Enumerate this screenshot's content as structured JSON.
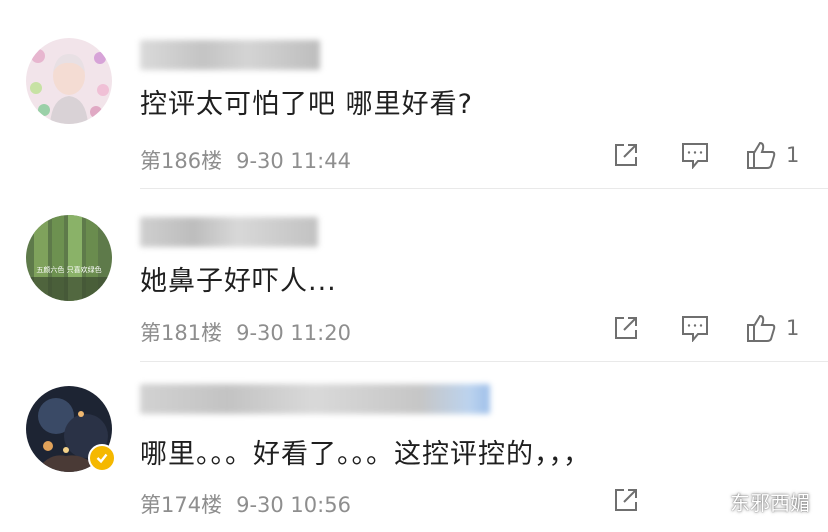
{
  "comments": [
    {
      "text": "控评太可怕了吧 哪里好看?",
      "floor": "第186楼",
      "time": "9-30 11:44",
      "likes": "1",
      "avatar_icon": "user-avatar-icon",
      "username_blurred": true
    },
    {
      "text": "她鼻子好吓人...",
      "floor": "第181楼",
      "time": "9-30 11:20",
      "likes": "1",
      "avatar_icon": "user-avatar-icon",
      "avatar_caption": "五颜六色 只喜欢绿色",
      "username_blurred": true
    },
    {
      "text": "哪里。。。好看了。。。这控评控的，，，",
      "floor": "第174楼",
      "time": "9-30 10:56",
      "likes": "",
      "avatar_icon": "user-avatar-icon",
      "verified_badge": "verified-badge-icon",
      "username_blurred": true
    }
  ],
  "actions": {
    "share_icon": "share-icon",
    "comment_icon": "comment-icon",
    "like_icon": "like-icon"
  },
  "watermark": {
    "icon": "wechat-icon",
    "text": "东邪西媚"
  },
  "colors": {
    "text": "#1f1f1f",
    "meta": "#8e8e8e",
    "icon": "#6f6f6f",
    "divider": "#e9e9e9",
    "verified": "#f5b800"
  }
}
